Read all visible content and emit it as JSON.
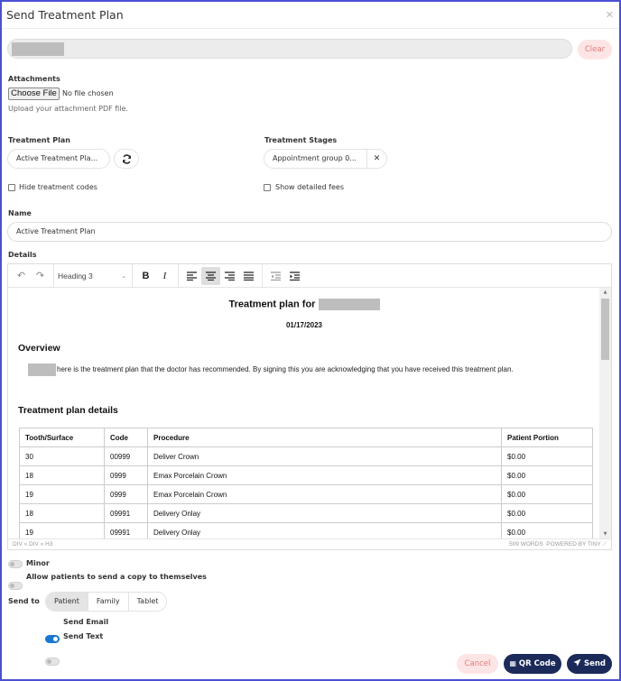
{
  "dialog": {
    "title": "Send Treatment Plan",
    "close_icon": "close-icon"
  },
  "patient": {
    "clear_label": "Clear"
  },
  "attachments": {
    "label": "Attachments",
    "choose_file_label": "Choose File",
    "file_status": "No file chosen",
    "helper": "Upload your attachment PDF file."
  },
  "treatment_plan": {
    "label": "Treatment Plan",
    "selected": "Active Treatment Pla...",
    "refresh_icon": "refresh-icon"
  },
  "treatment_stages": {
    "label": "Treatment Stages",
    "selected": "Appointment group 0...",
    "remove_icon": "close-icon"
  },
  "options": {
    "hide_codes": "Hide treatment codes",
    "hide_codes_checked": false,
    "show_fees": "Show detailed fees",
    "show_fees_checked": false
  },
  "name": {
    "label": "Name",
    "value": "Active Treatment Plan"
  },
  "details": {
    "label": "Details",
    "toolbar": {
      "block_format": "Heading 3",
      "bold": "B",
      "italic": "I"
    },
    "document": {
      "title_prefix": "Treatment plan for",
      "date": "01/17/2023",
      "overview_heading": "Overview",
      "overview_text": "here is the treatment plan that the doctor has recommended. By signing this you are acknowledging that you have received this treatment plan.",
      "details_heading": "Treatment plan details",
      "table": {
        "headers": [
          "Tooth/Surface",
          "Code",
          "Procedure",
          "Patient Portion"
        ],
        "rows": [
          [
            "30",
            "00999",
            "Deliver Crown",
            "$0.00"
          ],
          [
            "18",
            "0999",
            "Emax Porcelain Crown",
            "$0.00"
          ],
          [
            "19",
            "0999",
            "Emax Porcelain Crown",
            "$0.00"
          ],
          [
            "18",
            "09991",
            "Delivery Onlay",
            "$0.00"
          ],
          [
            "19",
            "09991",
            "Delivery Onlay",
            "$0.00"
          ]
        ]
      }
    },
    "status": {
      "path": "DIV » DIV » H3",
      "words": "509 WORDS",
      "powered": "POWERED BY TINY"
    }
  },
  "toggles": {
    "minor": "Minor",
    "minor_on": false,
    "allow_copy": "Allow patients to send a copy to themselves",
    "allow_copy_on": false
  },
  "send_to": {
    "label": "Send to",
    "options": [
      "Patient",
      "Family",
      "Tablet"
    ],
    "selected": "Patient",
    "send_email": "Send Email",
    "send_email_on": true,
    "send_text": "Send Text",
    "send_text_on": false
  },
  "footer": {
    "cancel": "Cancel",
    "qr_code": "QR Code",
    "send": "Send"
  },
  "colors": {
    "primary": "#1c2a5a",
    "danger_bg": "#fde5e5",
    "danger_text": "#e07b7b",
    "toggle_on": "#1976d2",
    "frame": "#4b50d2"
  }
}
